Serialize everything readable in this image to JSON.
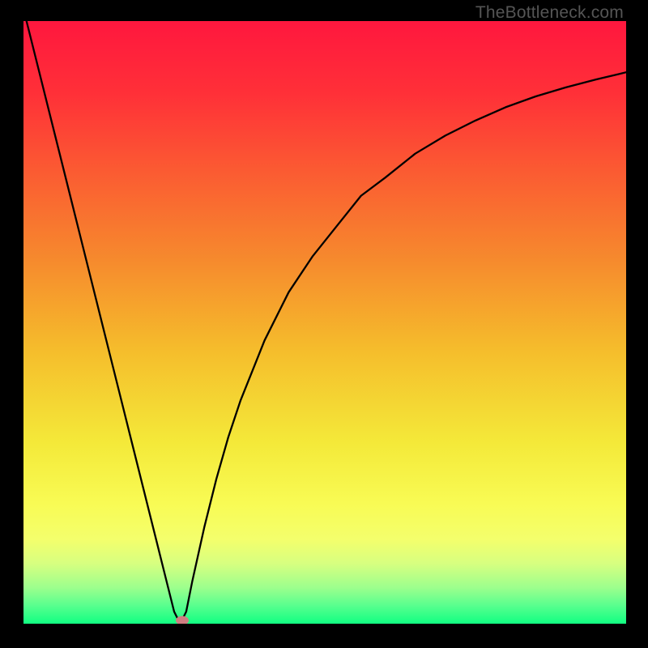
{
  "watermark": "TheBottleneck.com",
  "chart_data": {
    "type": "line",
    "title": "",
    "xlabel": "",
    "ylabel": "",
    "xlim": [
      0,
      100
    ],
    "ylim": [
      0,
      100
    ],
    "x": [
      0,
      2,
      4,
      6,
      8,
      10,
      12,
      14,
      16,
      18,
      20,
      22,
      24,
      25,
      26,
      27,
      28,
      30,
      32,
      34,
      36,
      38,
      40,
      44,
      48,
      52,
      56,
      60,
      65,
      70,
      75,
      80,
      85,
      90,
      95,
      100
    ],
    "values": [
      102,
      94,
      86,
      78,
      70,
      62,
      54,
      46,
      38,
      30,
      22,
      14,
      6,
      2,
      0,
      2,
      7,
      16,
      24,
      31,
      37,
      42,
      47,
      55,
      61,
      66,
      71,
      74,
      78,
      81,
      83.5,
      85.7,
      87.5,
      89,
      90.3,
      91.5
    ],
    "marker": {
      "x": 26.3,
      "y": 0.5,
      "color": "#cf7d81"
    },
    "gradient_stops": [
      {
        "offset": 0.0,
        "color": "#ff173e"
      },
      {
        "offset": 0.12,
        "color": "#ff3038"
      },
      {
        "offset": 0.25,
        "color": "#fb5b32"
      },
      {
        "offset": 0.4,
        "color": "#f68b2d"
      },
      {
        "offset": 0.55,
        "color": "#f5be2c"
      },
      {
        "offset": 0.7,
        "color": "#f4e939"
      },
      {
        "offset": 0.8,
        "color": "#f8fb54"
      },
      {
        "offset": 0.86,
        "color": "#f4ff6c"
      },
      {
        "offset": 0.9,
        "color": "#d7ff80"
      },
      {
        "offset": 0.94,
        "color": "#9dff8d"
      },
      {
        "offset": 0.97,
        "color": "#58ff8e"
      },
      {
        "offset": 1.0,
        "color": "#11ff82"
      }
    ]
  }
}
